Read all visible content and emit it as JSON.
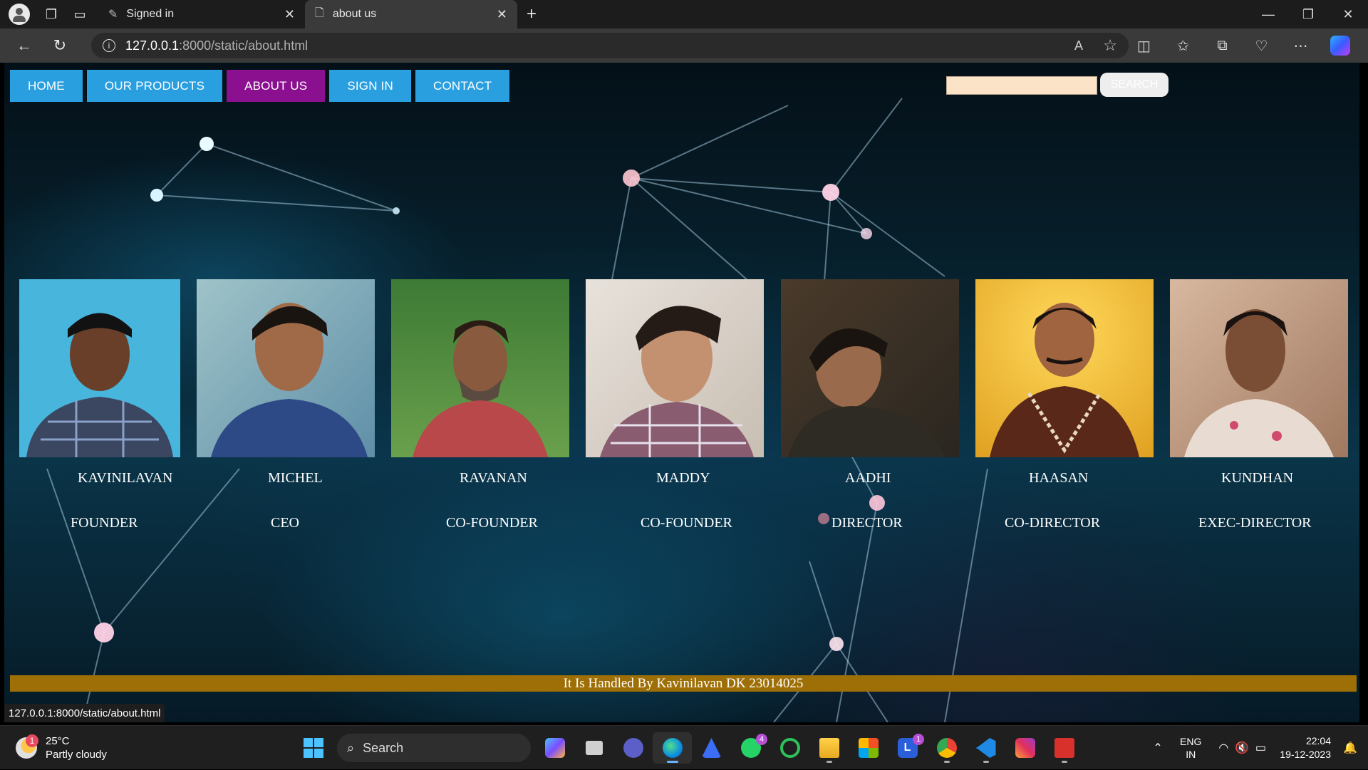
{
  "browser": {
    "tabs": [
      {
        "title": "Signed in",
        "active": false
      },
      {
        "title": "about us",
        "active": true
      }
    ],
    "address": {
      "host": "127.0.0.1",
      "rest": ":8000/static/about.html"
    },
    "status_url": "127.0.0.1:8000/static/about.html"
  },
  "nav": {
    "items": [
      {
        "label": "HOME",
        "active": false
      },
      {
        "label": "OUR PRODUCTS",
        "active": false
      },
      {
        "label": "ABOUT US",
        "active": true
      },
      {
        "label": "SIGN IN",
        "active": false
      },
      {
        "label": "CONTACT",
        "active": false
      }
    ],
    "search_placeholder": "",
    "search_button": "SEARCH"
  },
  "team": [
    {
      "name": "KAVINILAVAN",
      "role": "FOUNDER"
    },
    {
      "name": "MICHEL",
      "role": "CEO"
    },
    {
      "name": "RAVANAN",
      "role": "CO-FOUNDER"
    },
    {
      "name": "MADDY",
      "role": "CO-FOUNDER"
    },
    {
      "name": "AADHI",
      "role": "DIRECTOR"
    },
    {
      "name": "HAASAN",
      "role": "CO-DIRECTOR"
    },
    {
      "name": "KUNDHAN",
      "role": "EXEC-DIRECTOR"
    }
  ],
  "footer": {
    "text": "It Is Handled By Kavinilavan DK 23014025"
  },
  "taskbar": {
    "weather": {
      "temp": "25°C",
      "desc": "Partly cloudy",
      "badge": "1"
    },
    "search_label": "Search",
    "whatsapp_badge": "4",
    "l_badge": "1",
    "lang": [
      "ENG",
      "IN"
    ],
    "time": "22:04",
    "date": "19-12-2023"
  },
  "colors": {
    "nav_blue": "#2a9fe0",
    "nav_active": "#8a1090",
    "footer_bar": "#9e6f07"
  }
}
